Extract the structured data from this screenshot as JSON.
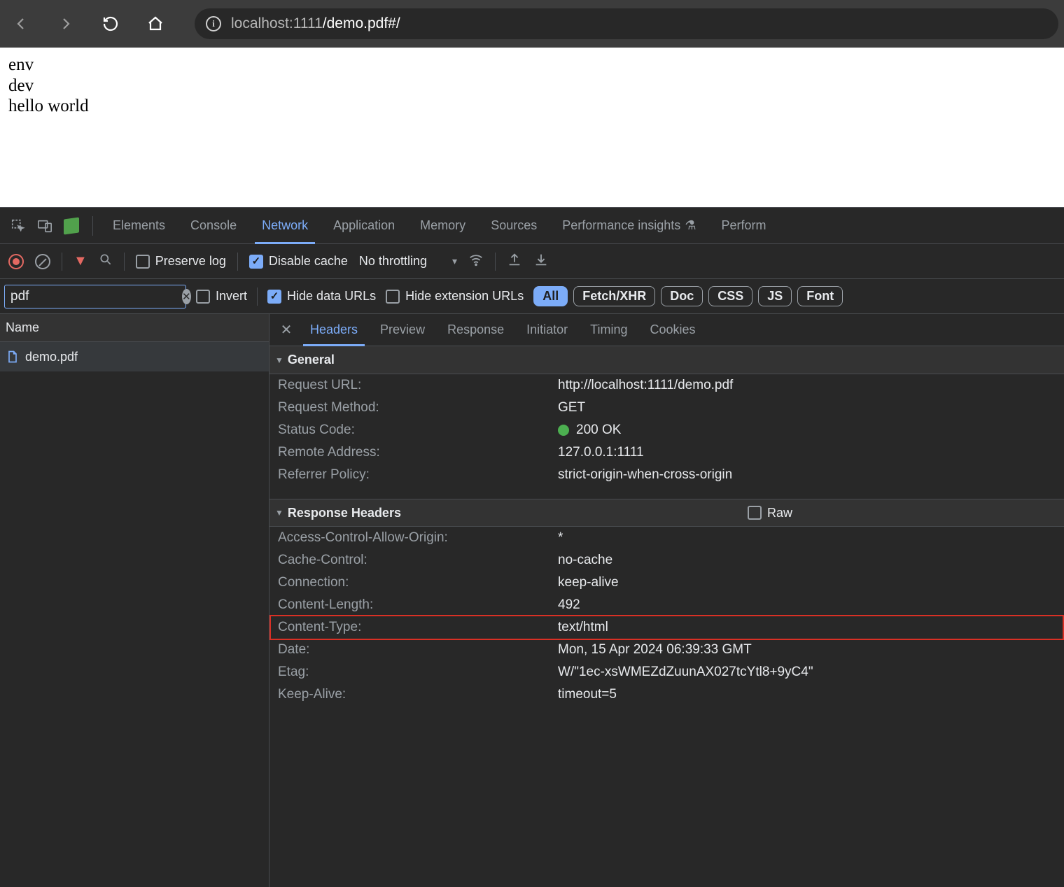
{
  "browser": {
    "url_host": "localhost:1111",
    "url_path": "/demo.pdf#/"
  },
  "page_lines": [
    "env",
    "dev",
    "hello world"
  ],
  "devtools": {
    "tabs": [
      "Elements",
      "Console",
      "Network",
      "Application",
      "Memory",
      "Sources",
      "Performance insights",
      "Perform"
    ],
    "active_tab": "Network",
    "toolbar": {
      "preserve_log_label": "Preserve log",
      "disable_cache_label": "Disable cache",
      "throttling": "No throttling"
    },
    "filter": {
      "value": "pdf",
      "invert_label": "Invert",
      "hide_data_label": "Hide data URLs",
      "hide_ext_label": "Hide extension URLs",
      "pills": [
        "All",
        "Fetch/XHR",
        "Doc",
        "CSS",
        "JS",
        "Font"
      ],
      "active_pill": "All"
    },
    "request_list": {
      "column": "Name",
      "items": [
        "demo.pdf"
      ]
    },
    "detail_tabs": [
      "Headers",
      "Preview",
      "Response",
      "Initiator",
      "Timing",
      "Cookies"
    ],
    "active_detail_tab": "Headers",
    "general": {
      "title": "General",
      "rows": [
        {
          "k": "Request URL:",
          "v": "http://localhost:1111/demo.pdf"
        },
        {
          "k": "Request Method:",
          "v": "GET"
        },
        {
          "k": "Status Code:",
          "v": "200 OK",
          "status": true
        },
        {
          "k": "Remote Address:",
          "v": "127.0.0.1:1111"
        },
        {
          "k": "Referrer Policy:",
          "v": "strict-origin-when-cross-origin"
        }
      ]
    },
    "response_headers": {
      "title": "Response Headers",
      "raw_label": "Raw",
      "rows": [
        {
          "k": "Access-Control-Allow-Origin:",
          "v": "*"
        },
        {
          "k": "Cache-Control:",
          "v": "no-cache"
        },
        {
          "k": "Connection:",
          "v": "keep-alive"
        },
        {
          "k": "Content-Length:",
          "v": "492"
        },
        {
          "k": "Content-Type:",
          "v": "text/html",
          "highlight": true
        },
        {
          "k": "Date:",
          "v": "Mon, 15 Apr 2024 06:39:33 GMT"
        },
        {
          "k": "Etag:",
          "v": "W/\"1ec-xsWMEZdZuunAX027tcYtl8+9yC4\""
        },
        {
          "k": "Keep-Alive:",
          "v": "timeout=5"
        }
      ]
    }
  }
}
